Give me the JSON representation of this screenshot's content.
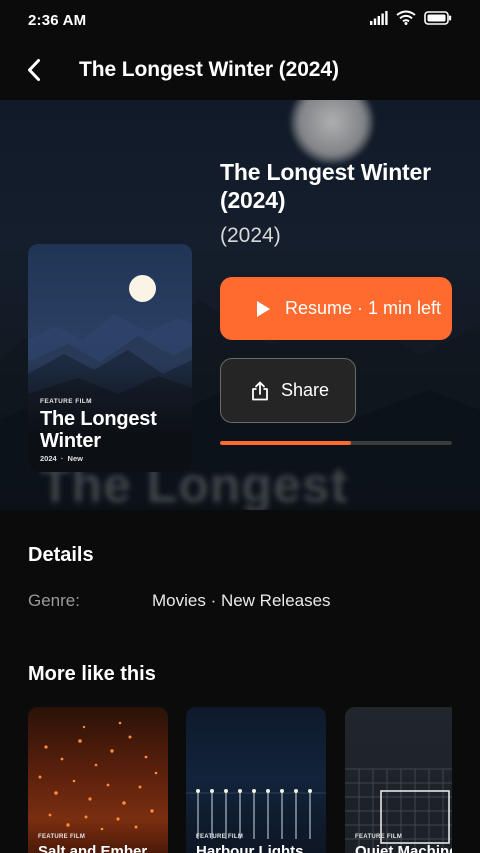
{
  "status_bar": {
    "time": "2:36 AM"
  },
  "app_bar": {
    "title": "The Longest Winter (2024)"
  },
  "hero": {
    "background_text": "The Longest"
  },
  "poster": {
    "kicker": "FEATURE FILM",
    "title": "The Longest Winter",
    "year": "2024",
    "badge": "New"
  },
  "movie": {
    "title": "The Longest Winter (2024)",
    "year": "(2024)"
  },
  "actions": {
    "resume_label": "Resume · 1 min left",
    "share_label": "Share"
  },
  "playback": {
    "progress_fraction": 0.565
  },
  "details": {
    "heading": "Details",
    "genre_label": "Genre:",
    "genre_value": "Movies · New Releases"
  },
  "more": {
    "heading": "More like this",
    "items": [
      {
        "kicker": "FEATURE FILM",
        "title": "Salt and Ember"
      },
      {
        "kicker": "FEATURE FILM",
        "title": "Harbour Lights"
      },
      {
        "kicker": "FEATURE FILM",
        "title": "Quiet Machines"
      }
    ]
  },
  "colors": {
    "accent": "#ff6a2e",
    "background": "#0b0b0b",
    "surface": "#252525"
  }
}
